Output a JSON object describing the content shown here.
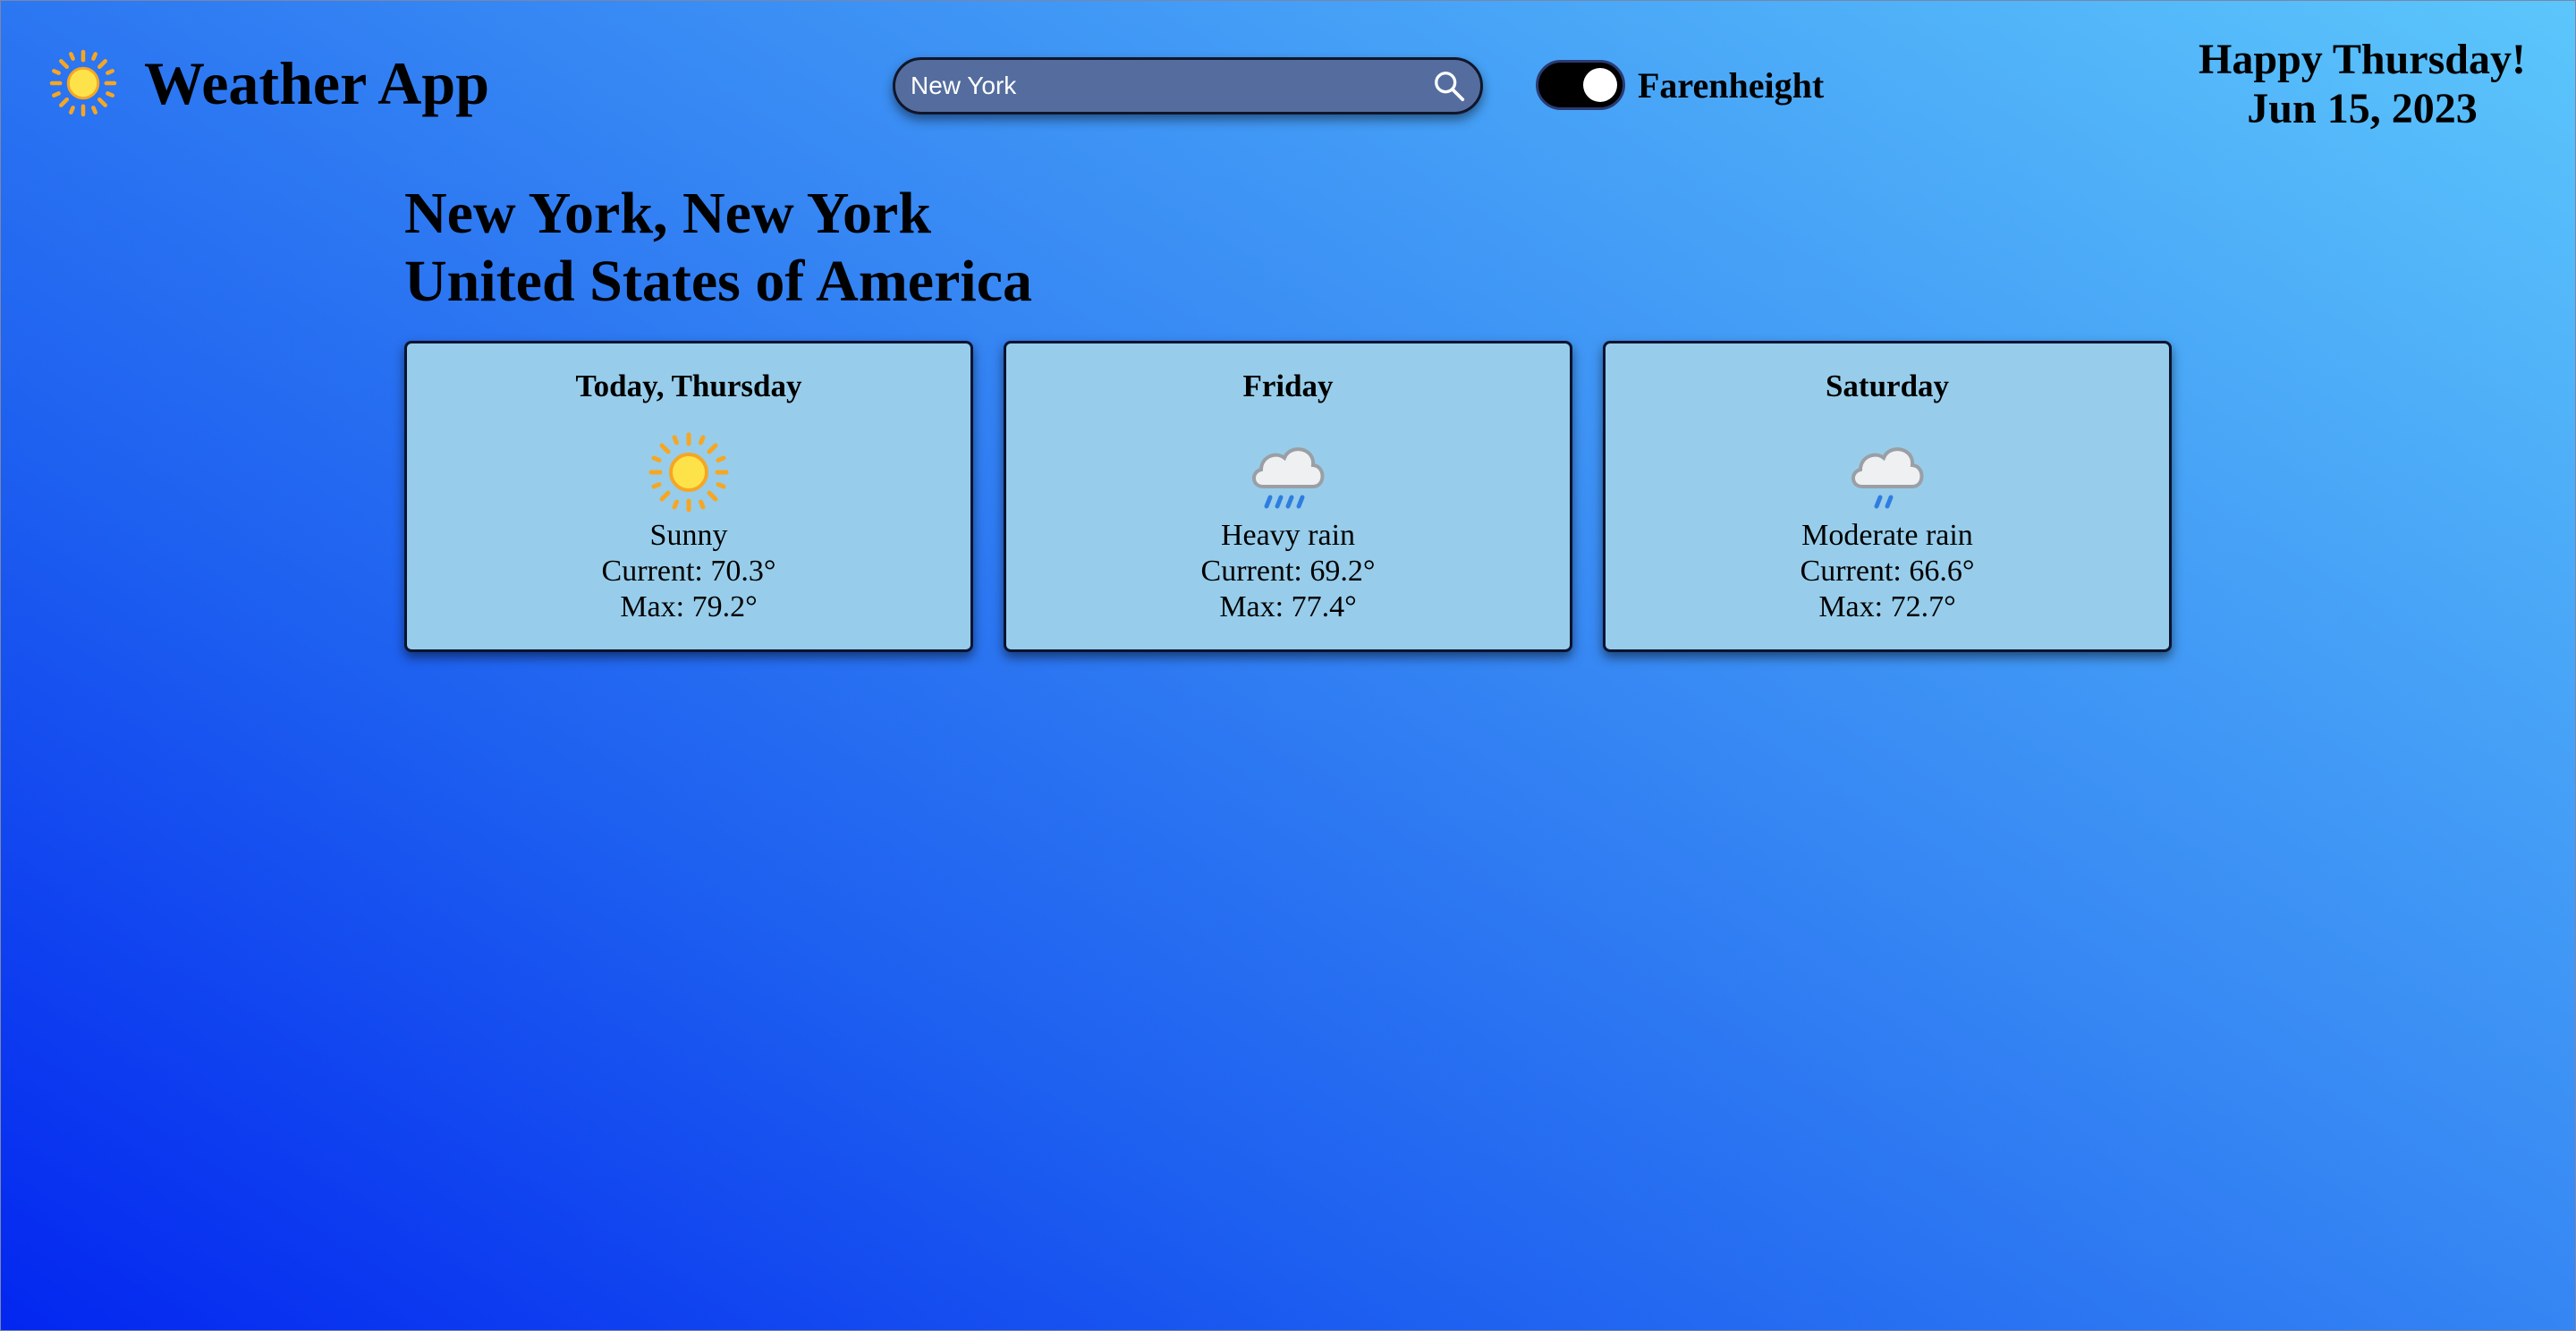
{
  "header": {
    "app_title": "Weather App",
    "app_icon": "sun-icon",
    "search": {
      "value": "New York",
      "icon": "search-icon"
    },
    "units_toggle": {
      "label": "Farenheight",
      "state": "on"
    },
    "greeting": "Happy Thursday!",
    "date": "Jun 15, 2023"
  },
  "location": {
    "line1": "New York, New York",
    "line2": "United States of America"
  },
  "forecast": [
    {
      "day": "Today, Thursday",
      "icon": "sun-icon",
      "condition": "Sunny",
      "current": "Current: 70.3°",
      "max": "Max: 79.2°"
    },
    {
      "day": "Friday",
      "icon": "heavy-rain-icon",
      "condition": "Heavy rain",
      "current": "Current: 69.2°",
      "max": "Max: 77.4°"
    },
    {
      "day": "Saturday",
      "icon": "moderate-rain-icon",
      "condition": "Moderate rain",
      "current": "Current: 66.6°",
      "max": "Max: 72.7°"
    }
  ],
  "colors": {
    "card_background": "#97cdea",
    "search_background": "#546d9e",
    "sun": "#fde24a",
    "sun_rays": "#f6a623",
    "rain": "#2f7de1"
  }
}
